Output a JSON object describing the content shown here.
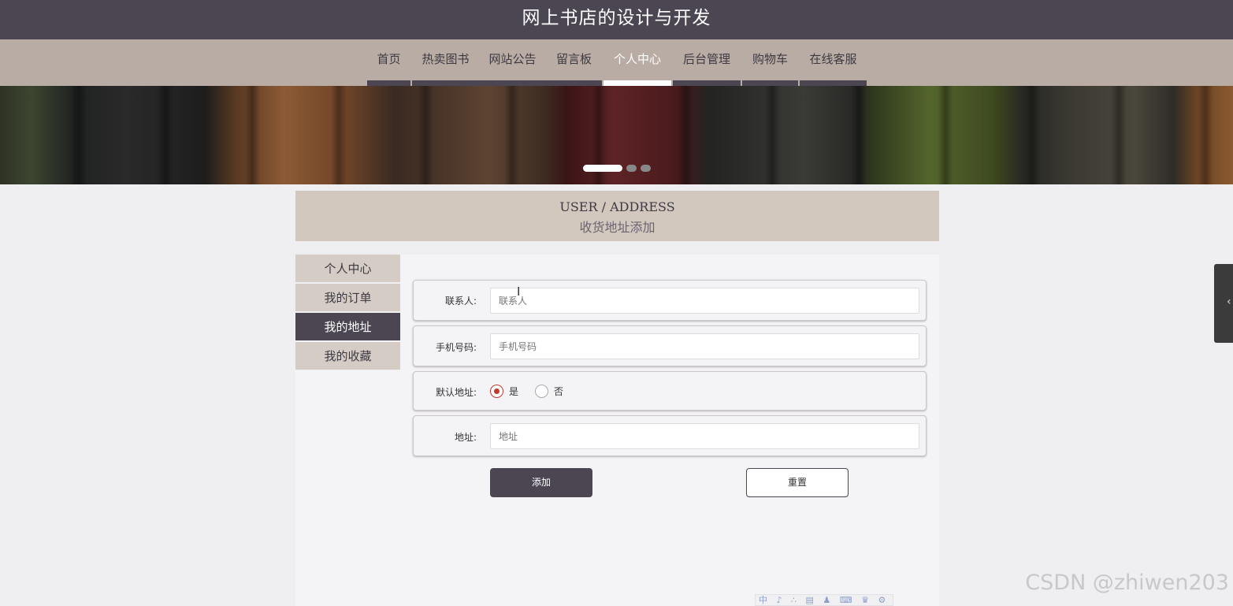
{
  "header": {
    "title": "网上书店的设计与开发"
  },
  "nav": {
    "items": [
      {
        "label": "首页",
        "active": false
      },
      {
        "label": "热卖图书",
        "active": false
      },
      {
        "label": "网站公告",
        "active": false
      },
      {
        "label": "留言板",
        "active": false
      },
      {
        "label": "个人中心",
        "active": true
      },
      {
        "label": "后台管理",
        "active": false
      },
      {
        "label": "购物车",
        "active": false
      },
      {
        "label": "在线客服",
        "active": false
      }
    ]
  },
  "banner": {
    "slide_count": 3,
    "active_slide": 1
  },
  "section": {
    "title_en": "USER / ADDRESS",
    "title_cn": "收货地址添加"
  },
  "sidebar": {
    "items": [
      {
        "label": "个人中心",
        "active": false
      },
      {
        "label": "我的订单",
        "active": false
      },
      {
        "label": "我的地址",
        "active": true
      },
      {
        "label": "我的收藏",
        "active": false
      }
    ]
  },
  "form": {
    "contact": {
      "label": "联系人:",
      "placeholder": "联系人"
    },
    "phone": {
      "label": "手机号码:",
      "placeholder": "手机号码"
    },
    "default_address": {
      "label": "默认地址:",
      "options": [
        {
          "label": "是",
          "checked": true
        },
        {
          "label": "否",
          "checked": false
        }
      ]
    },
    "address": {
      "label": "地址:",
      "placeholder": "地址"
    },
    "submit_label": "添加",
    "reset_label": "重置"
  },
  "colors": {
    "primary": "#4c4653",
    "nav_bg": "#b8aca4",
    "heading_bg": "#d2c8be",
    "radio_accent": "#c0392b"
  },
  "watermark": "CSDN @zhiwen203",
  "ime_toolbar": "中 ♪ ∴ ▤ ♟ ⌨ ♛ ⚙"
}
